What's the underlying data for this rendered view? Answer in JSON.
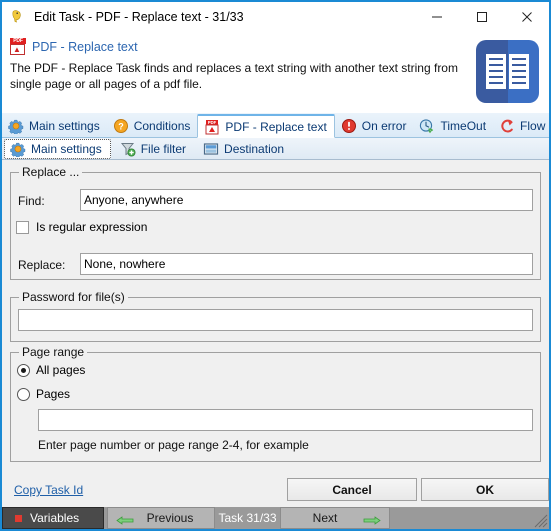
{
  "window": {
    "title": "Edit Task - PDF - Replace text - 31/33",
    "app_icon": "parrot-icon",
    "minimize_label": "—",
    "maximize_label": "□",
    "close_label": "✕"
  },
  "header": {
    "icon": "pdf-file-icon",
    "title": "PDF - Replace text",
    "description": "The PDF - Replace Task finds and replaces a text string with another text string from single page or all pages of a pdf file.",
    "side_icon": "open-book-icon"
  },
  "tabs": [
    {
      "label": "Main settings",
      "icon": "gear-icon",
      "active": false
    },
    {
      "label": "Conditions",
      "icon": "question-mark-icon",
      "active": false
    },
    {
      "label": "PDF - Replace text",
      "icon": "pdf-file-icon",
      "active": true
    },
    {
      "label": "On error",
      "icon": "error-circle-icon",
      "active": false
    },
    {
      "label": "TimeOut",
      "icon": "clock-refresh-icon",
      "active": false
    },
    {
      "label": "Flow",
      "icon": "flow-arrow-icon",
      "active": false
    }
  ],
  "subtabs": [
    {
      "label": "Main settings",
      "icon": "gear-icon",
      "active": true
    },
    {
      "label": "File filter",
      "icon": "funnel-add-icon",
      "active": false
    },
    {
      "label": "Destination",
      "icon": "monitor-icon",
      "active": false
    }
  ],
  "replace_group": {
    "legend": "Replace ...",
    "find_label": "Find:",
    "find_value": "Anyone, anywhere",
    "find_placeholder": "",
    "regex_label": "Is regular expression",
    "regex_checked": false,
    "replace_label": "Replace:",
    "replace_value": "None, nowhere",
    "replace_placeholder": ""
  },
  "password_group": {
    "legend": "Password for file(s)",
    "value": "",
    "placeholder": ""
  },
  "page_range_group": {
    "legend": "Page range",
    "all_pages_label": "All pages",
    "all_pages_selected": true,
    "pages_label": "Pages",
    "pages_selected": false,
    "pages_value": "",
    "pages_placeholder": "",
    "hint": "Enter page number or page range 2-4, for example"
  },
  "footer": {
    "copy_task_id_label": "Copy Task Id",
    "cancel_label": "Cancel",
    "ok_label": "OK"
  },
  "statusbar": {
    "variables_label": "Variables",
    "previous_label": "Previous",
    "task_label": "Task 31/33",
    "next_label": "Next"
  },
  "colors": {
    "window_border": "#1a8ad4",
    "accent_link": "#1f5fa8",
    "tab_text": "#0b3a73",
    "header_title": "#2c66b0",
    "book_dark": "#3a5ba0",
    "book_light": "#3b6fc4",
    "pdf_red": "#e02020",
    "status_dark": "#4a4a4a",
    "status_gray": "#9a9a9a",
    "arrow_green": "#4caf50"
  }
}
